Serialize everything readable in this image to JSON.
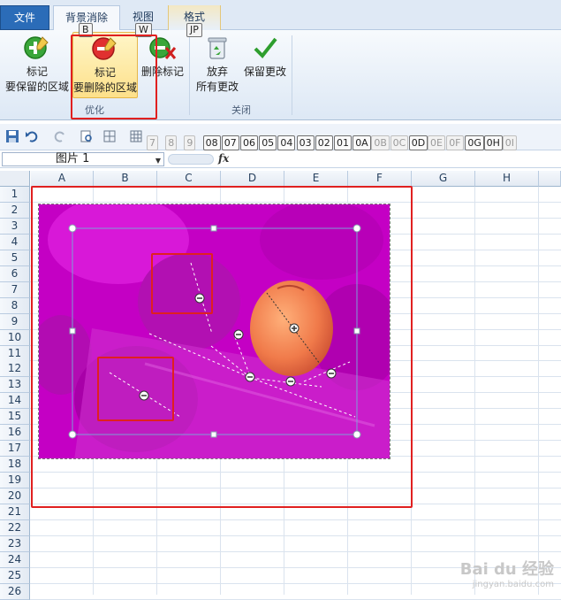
{
  "tabs": {
    "file": "文件",
    "background_removal": "背景消除",
    "view": "视图",
    "format": "格式"
  },
  "keytips": {
    "background_removal": "B",
    "view": "W",
    "format": "JP"
  },
  "ribbon": {
    "mark_keep": {
      "line1": "标记",
      "line2": "要保留的区域"
    },
    "mark_remove": {
      "line1": "标记",
      "line2": "要删除的区域"
    },
    "delete_mark": "删除标记",
    "group_refine": "优化",
    "discard": {
      "line1": "放弃",
      "line2": "所有更改"
    },
    "keep_changes": "保留更改",
    "group_close": "关闭"
  },
  "qat_keytips": [
    "7",
    "8",
    "9",
    "08",
    "07",
    "06",
    "05",
    "04",
    "03",
    "02",
    "01",
    "0A",
    "0B",
    "0C",
    "0D",
    "0E",
    "0F",
    "0G",
    "0H",
    "0I"
  ],
  "formula_bar": {
    "name_box": "图片 1",
    "fx": "fx"
  },
  "columns": [
    "A",
    "B",
    "C",
    "D",
    "E",
    "F",
    "G",
    "H"
  ],
  "rows": [
    "1",
    "2",
    "3",
    "4",
    "5",
    "6",
    "7",
    "8",
    "9",
    "10",
    "11",
    "12",
    "13",
    "14",
    "15",
    "16",
    "17",
    "18",
    "19",
    "20",
    "21",
    "22",
    "23",
    "24",
    "25",
    "26"
  ],
  "watermark": {
    "text": "Bai du 经验",
    "sub": "jingyan.baidu.com"
  },
  "colors": {
    "highlight_red": "#e02020",
    "removed_area_magenta": "#c400c4",
    "ribbon_selected": "#fde08a"
  }
}
